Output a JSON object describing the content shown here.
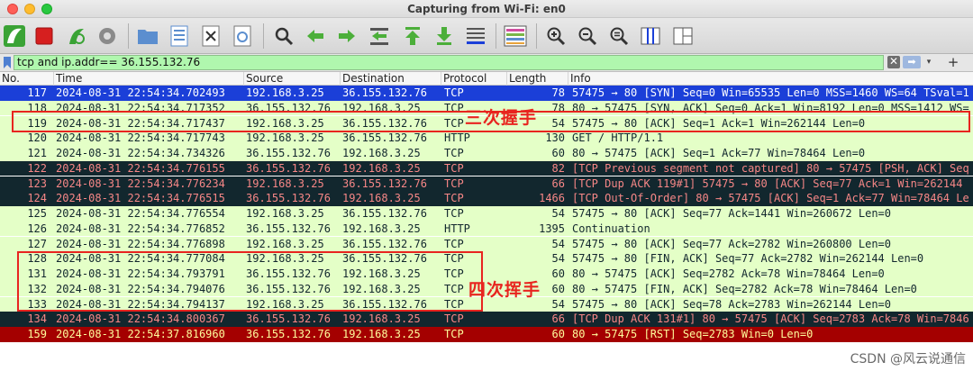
{
  "window": {
    "title": "Capturing from Wi-Fi: en0"
  },
  "toolbar": {
    "buttons": [
      {
        "name": "start-capture-icon",
        "color": "#3aa335"
      },
      {
        "name": "stop-capture-icon",
        "color": "#d61f1f"
      },
      {
        "name": "restart-capture-icon",
        "color": "#3aa335"
      },
      {
        "name": "capture-options-icon",
        "color": "#555555"
      },
      {
        "name": "open-file-icon",
        "color": "#5b8ecf"
      },
      {
        "name": "save-file-icon",
        "color": "#5b8ecf"
      },
      {
        "name": "close-file-icon",
        "color": "#555555"
      },
      {
        "name": "reload-file-icon",
        "color": "#5b8ecf"
      },
      {
        "name": "find-packet-icon",
        "color": "#333333"
      },
      {
        "name": "go-back-icon",
        "color": "#4caf3a"
      },
      {
        "name": "go-forward-icon",
        "color": "#4caf3a"
      },
      {
        "name": "go-to-packet-icon",
        "color": "#4caf3a"
      },
      {
        "name": "go-first-icon",
        "color": "#4caf3a"
      },
      {
        "name": "go-last-icon",
        "color": "#4caf3a"
      },
      {
        "name": "autoscroll-icon",
        "color": "#555555"
      },
      {
        "name": "colorize-icon",
        "color": "#d04ea0"
      },
      {
        "name": "zoom-in-icon",
        "color": "#333333"
      },
      {
        "name": "zoom-out-icon",
        "color": "#333333"
      },
      {
        "name": "normal-size-icon",
        "color": "#333333"
      },
      {
        "name": "resize-columns-icon",
        "color": "#555555"
      },
      {
        "name": "split-view-icon",
        "color": "#555555"
      }
    ]
  },
  "filter": {
    "value": "tcp and ip.addr== 36.155.132.76",
    "clear_glyph": "✕",
    "apply_glyph": "➡",
    "dropdown_glyph": "▾",
    "add_glyph": "+"
  },
  "columns": {
    "no": "No.",
    "time": "Time",
    "source": "Source",
    "destination": "Destination",
    "protocol": "Protocol",
    "length": "Length",
    "info": "Info"
  },
  "packets": [
    {
      "no": "117",
      "time": "2024-08-31 22:54:34.702493",
      "src": "192.168.3.25",
      "dst": "36.155.132.76",
      "proto": "TCP",
      "len": "78",
      "info": "57475 → 80 [SYN] Seq=0 Win=65535 Len=0 MSS=1460 WS=64 TSval=1",
      "style": "sel"
    },
    {
      "no": "118",
      "time": "2024-08-31 22:54:34.717352",
      "src": "36.155.132.76",
      "dst": "192.168.3.25",
      "proto": "TCP",
      "len": "78",
      "info": "80 → 57475 [SYN, ACK] Seq=0 Ack=1 Win=8192 Len=0 MSS=1412 WS=",
      "style": "green"
    },
    {
      "no": "119",
      "time": "2024-08-31 22:54:34.717437",
      "src": "192.168.3.25",
      "dst": "36.155.132.76",
      "proto": "TCP",
      "len": "54",
      "info": "57475 → 80 [ACK] Seq=1 Ack=1 Win=262144 Len=0",
      "style": "green"
    },
    {
      "no": "120",
      "time": "2024-08-31 22:54:34.717743",
      "src": "192.168.3.25",
      "dst": "36.155.132.76",
      "proto": "HTTP",
      "len": "130",
      "info": "GET / HTTP/1.1",
      "style": "green"
    },
    {
      "no": "121",
      "time": "2024-08-31 22:54:34.734326",
      "src": "36.155.132.76",
      "dst": "192.168.3.25",
      "proto": "TCP",
      "len": "60",
      "info": "80 → 57475 [ACK] Seq=1 Ack=77 Win=78464 Len=0",
      "style": "green"
    },
    {
      "no": "122",
      "time": "2024-08-31 22:54:34.776155",
      "src": "36.155.132.76",
      "dst": "192.168.3.25",
      "proto": "TCP",
      "len": "82",
      "info": "[TCP Previous segment not captured] 80 → 57475 [PSH, ACK] Seq",
      "style": "bad"
    },
    {
      "no": "123",
      "time": "2024-08-31 22:54:34.776234",
      "src": "192.168.3.25",
      "dst": "36.155.132.76",
      "proto": "TCP",
      "len": "66",
      "info": "[TCP Dup ACK 119#1] 57475 → 80 [ACK] Seq=77 Ack=1 Win=262144",
      "style": "bad"
    },
    {
      "no": "124",
      "time": "2024-08-31 22:54:34.776515",
      "src": "36.155.132.76",
      "dst": "192.168.3.25",
      "proto": "TCP",
      "len": "1466",
      "info": "[TCP Out-Of-Order] 80 → 57475 [ACK] Seq=1 Ack=77 Win=78464 Le",
      "style": "bad"
    },
    {
      "no": "125",
      "time": "2024-08-31 22:54:34.776554",
      "src": "192.168.3.25",
      "dst": "36.155.132.76",
      "proto": "TCP",
      "len": "54",
      "info": "57475 → 80 [ACK] Seq=77 Ack=1441 Win=260672 Len=0",
      "style": "green"
    },
    {
      "no": "126",
      "time": "2024-08-31 22:54:34.776852",
      "src": "36.155.132.76",
      "dst": "192.168.3.25",
      "proto": "HTTP",
      "len": "1395",
      "info": "Continuation",
      "style": "green"
    },
    {
      "no": "127",
      "time": "2024-08-31 22:54:34.776898",
      "src": "192.168.3.25",
      "dst": "36.155.132.76",
      "proto": "TCP",
      "len": "54",
      "info": "57475 → 80 [ACK] Seq=77 Ack=2782 Win=260800 Len=0",
      "style": "green"
    },
    {
      "no": "128",
      "time": "2024-08-31 22:54:34.777084",
      "src": "192.168.3.25",
      "dst": "36.155.132.76",
      "proto": "TCP",
      "len": "54",
      "info": "57475 → 80 [FIN, ACK] Seq=77 Ack=2782 Win=262144 Len=0",
      "style": "green"
    },
    {
      "no": "131",
      "time": "2024-08-31 22:54:34.793791",
      "src": "36.155.132.76",
      "dst": "192.168.3.25",
      "proto": "TCP",
      "len": "60",
      "info": "80 → 57475 [ACK] Seq=2782 Ack=78 Win=78464 Len=0",
      "style": "green"
    },
    {
      "no": "132",
      "time": "2024-08-31 22:54:34.794076",
      "src": "36.155.132.76",
      "dst": "192.168.3.25",
      "proto": "TCP",
      "len": "60",
      "info": "80 → 57475 [FIN, ACK] Seq=2782 Ack=78 Win=78464 Len=0",
      "style": "green"
    },
    {
      "no": "133",
      "time": "2024-08-31 22:54:34.794137",
      "src": "192.168.3.25",
      "dst": "36.155.132.76",
      "proto": "TCP",
      "len": "54",
      "info": "57475 → 80 [ACK] Seq=78 Ack=2783 Win=262144 Len=0",
      "style": "green"
    },
    {
      "no": "134",
      "time": "2024-08-31 22:54:34.800367",
      "src": "36.155.132.76",
      "dst": "192.168.3.25",
      "proto": "TCP",
      "len": "66",
      "info": "[TCP Dup ACK 131#1] 80 → 57475 [ACK] Seq=2783 Ack=78 Win=7846",
      "style": "bad"
    },
    {
      "no": "159",
      "time": "2024-08-31 22:54:37.816960",
      "src": "36.155.132.76",
      "dst": "192.168.3.25",
      "proto": "TCP",
      "len": "60",
      "info": "80 → 57475 [RST] Seq=2783 Win=0 Len=0",
      "style": "rst"
    }
  ],
  "annotations": {
    "handshake": "三次握手",
    "teardown": "四次挥手",
    "color": "#e8241f"
  },
  "watermark": "CSDN @风云说通信"
}
